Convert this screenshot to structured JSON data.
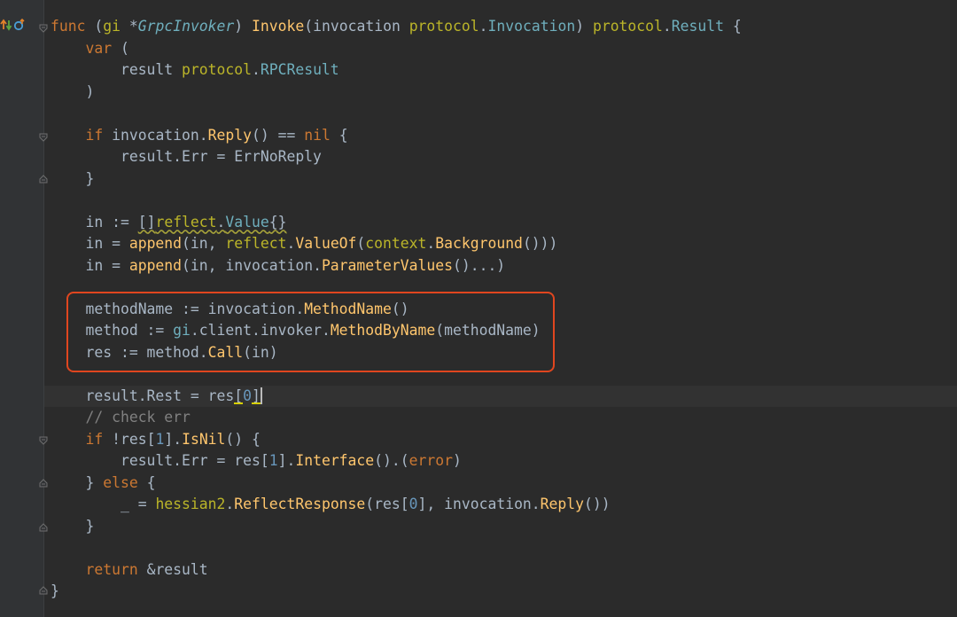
{
  "editor": {
    "lines": {
      "l1": {
        "func": "func",
        "open": " (",
        "gi": "gi",
        "star": " *",
        "recv": "GrpcInvoker",
        "close": ") ",
        "name": "Invoke",
        "p1": "(invocation ",
        "pkg": "protocol",
        "dot1": ".",
        "type1": "Invocation",
        "p2": ") ",
        "pkg2": "protocol",
        "dot2": ".",
        "type2": "Result",
        "brace": " {"
      },
      "l2": {
        "indent": "    ",
        "var": "var",
        "rest": " ("
      },
      "l3": {
        "indent": "        ",
        "a": "result ",
        "pkg": "protocol",
        "dot": ".",
        "type": "RPCResult"
      },
      "l4": {
        "indent": "    ",
        "a": ")"
      },
      "l6": {
        "indent": "    ",
        "if": "if",
        "a": " invocation.",
        "fn": "Reply",
        "b": "() == ",
        "nil": "nil",
        "c": " {"
      },
      "l7": {
        "indent": "        ",
        "a": "result.Err = ErrNoReply"
      },
      "l8": {
        "indent": "    ",
        "a": "}"
      },
      "l10": {
        "indent": "    ",
        "a": "in := ",
        "b": "[]",
        "pkg": "reflect",
        "dot": ".",
        "type": "Value",
        "c": "{}"
      },
      "l11": {
        "indent": "    ",
        "a": "in = ",
        "fn": "append",
        "b": "(in, ",
        "pkg": "reflect",
        "dot": ".",
        "fn2": "ValueOf",
        "c": "(",
        "pkg2": "context",
        "dot2": ".",
        "fn3": "Background",
        "d": "()))"
      },
      "l12": {
        "indent": "    ",
        "a": "in = ",
        "fn": "append",
        "b": "(in, invocation.",
        "fn2": "ParameterValues",
        "c": "()...)"
      },
      "l14": {
        "indent": "    ",
        "a": "methodName := invocation.",
        "fn": "MethodName",
        "b": "()"
      },
      "l15": {
        "indent": "    ",
        "a": "method := ",
        "gi": "gi",
        "b": ".client.invoker.",
        "fn": "MethodByName",
        "c": "(methodName)"
      },
      "l16": {
        "indent": "    ",
        "a": "res := method.",
        "fn": "Call",
        "b": "(in)"
      },
      "l18": {
        "indent": "    ",
        "a": "result.Rest = res",
        "ob": "[",
        "num": "0",
        "cb": "]"
      },
      "l19": {
        "indent": "    ",
        "comment": "// check err"
      },
      "l20": {
        "indent": "    ",
        "if": "if",
        "a": " !res[",
        "num": "1",
        "b": "].",
        "fn": "IsNil",
        "c": "() {"
      },
      "l21": {
        "indent": "        ",
        "a": "result.Err = res[",
        "num": "1",
        "b": "].",
        "fn": "Interface",
        "c": "().(",
        "err": "error",
        "d": ")"
      },
      "l22": {
        "indent": "    ",
        "a": "} ",
        "else": "else",
        "b": " {"
      },
      "l23": {
        "indent": "        ",
        "a": "_ = ",
        "pkg": "hessian2",
        "dot": ".",
        "fn": "ReflectResponse",
        "b": "(res[",
        "num": "0",
        "c": "], invocation.",
        "fn2": "Reply",
        "d": "())"
      },
      "l24": {
        "indent": "    ",
        "a": "}"
      },
      "l26": {
        "indent": "    ",
        "ret": "return",
        "a": " &result"
      },
      "l27": {
        "a": "}"
      }
    }
  },
  "gutter": {
    "run_icon": "run-arrows-icon",
    "impl_icon": "implements-icon",
    "fold_icon": "fold-marker-icon"
  },
  "colors": {
    "background": "#2b2b2b",
    "text": "#a9b7c6",
    "keyword": "#cc7832",
    "function": "#ffc66d",
    "type": "#6fafbd",
    "package": "#bbb529",
    "number": "#6897bb",
    "comment": "#808080",
    "highlight_box": "#e0461f"
  }
}
